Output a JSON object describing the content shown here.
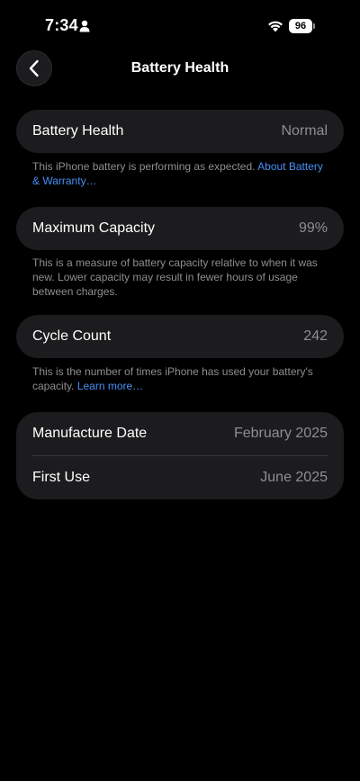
{
  "status_bar": {
    "time": "7:34",
    "battery_level": "96"
  },
  "nav": {
    "title": "Battery Health"
  },
  "battery_health": {
    "label": "Battery Health",
    "value": "Normal",
    "note": "This iPhone battery is performing as expected.",
    "link": "About Battery & Warranty…"
  },
  "maximum_capacity": {
    "label": "Maximum Capacity",
    "value": "99%",
    "note": "This is a measure of battery capacity relative to when it was new. Lower capacity may result in fewer hours of usage between charges."
  },
  "cycle_count": {
    "label": "Cycle Count",
    "value": "242",
    "note": "This is the number of times iPhone has used your battery's capacity.",
    "link": "Learn more…"
  },
  "dates": {
    "manufacture_label": "Manufacture Date",
    "manufacture_value": "February 2025",
    "first_use_label": "First Use",
    "first_use_value": "June 2025"
  },
  "colors": {
    "background": "#000000",
    "card": "#1c1c1e",
    "secondary_text": "#8e8e93",
    "link": "#4a8ff5"
  }
}
